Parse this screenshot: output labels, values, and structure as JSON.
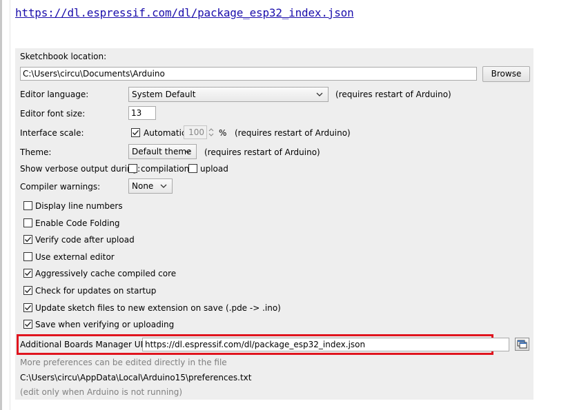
{
  "top_url": "https://dl.espressif.com/dl/package_esp32_index.json",
  "sketchbook": {
    "label": "Sketchbook location:",
    "value": "C:\\Users\\circu\\Documents\\Arduino",
    "browse_label": "Browse"
  },
  "editor_language": {
    "label": "Editor language:",
    "value": "System Default",
    "note": "(requires restart of Arduino)"
  },
  "font_size": {
    "label": "Editor font size:",
    "value": "13"
  },
  "interface_scale": {
    "label": "Interface scale:",
    "automatic_label": "Automatic",
    "automatic_checked": true,
    "value": "100",
    "unit": "%",
    "note": "(requires restart of Arduino)"
  },
  "theme": {
    "label": "Theme:",
    "value": "Default theme",
    "note": "(requires restart of Arduino)"
  },
  "verbose": {
    "label": "Show verbose output during:",
    "compilation_label": "compilation",
    "compilation_checked": false,
    "upload_label": "upload",
    "upload_checked": false
  },
  "compiler_warnings": {
    "label": "Compiler warnings:",
    "value": "None"
  },
  "options": [
    {
      "label": "Display line numbers",
      "checked": false
    },
    {
      "label": "Enable Code Folding",
      "checked": false
    },
    {
      "label": "Verify code after upload",
      "checked": true
    },
    {
      "label": "Use external editor",
      "checked": false
    },
    {
      "label": "Aggressively cache compiled core",
      "checked": true
    },
    {
      "label": "Check for updates on startup",
      "checked": true
    },
    {
      "label": "Update sketch files to new extension on save (.pde -> .ino)",
      "checked": true
    },
    {
      "label": "Save when verifying or uploading",
      "checked": true
    }
  ],
  "boards_urls": {
    "label": "Additional Boards Manager URLs:",
    "value": "https://dl.espressif.com/dl/package_esp32_index.json"
  },
  "footer": {
    "more_prefs": "More preferences can be edited directly in the file",
    "prefs_path": "C:\\Users\\circu\\AppData\\Local\\Arduino15\\preferences.txt",
    "edit_note": "(edit only when Arduino is not running)"
  },
  "colors": {
    "highlight": "#e0141e",
    "link": "#1a0dab",
    "panel": "#eeeeee"
  }
}
